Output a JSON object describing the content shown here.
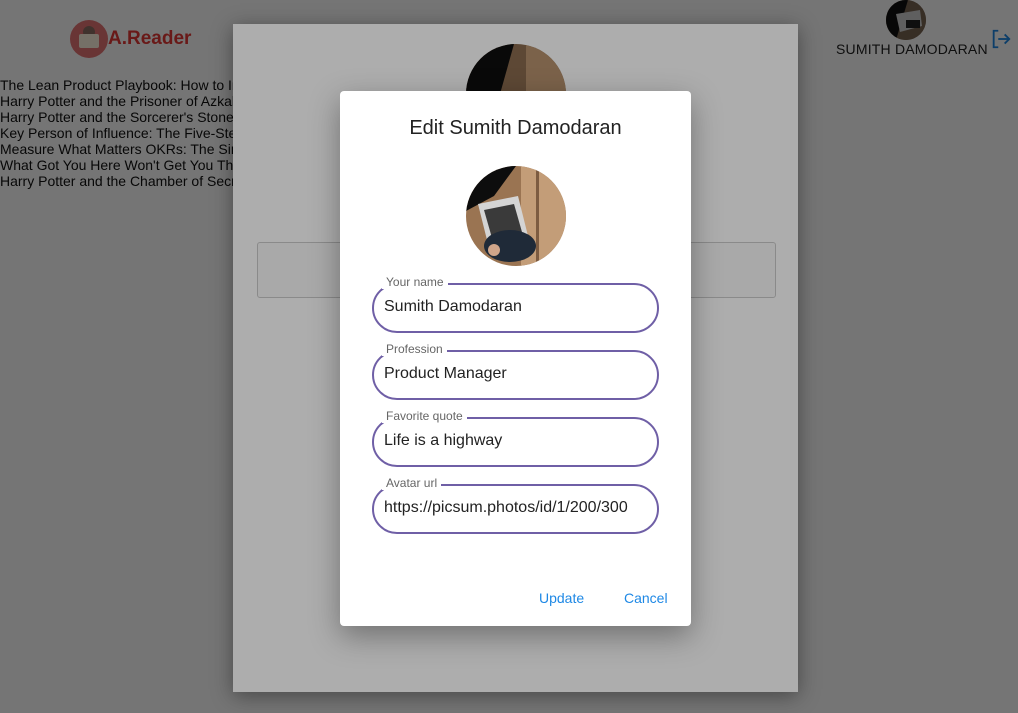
{
  "app": {
    "logo_text": "A.Reader"
  },
  "user": {
    "name": "SUMITH DAMODARAN"
  },
  "books": [
    "The Lean Product Playbook: How to Innovate with Minimum Viable Products",
    "Harry Potter and the Prisoner of Azkaban",
    "Harry Potter and the Sorcerer's Stone",
    "Key Person of Influence: The Five-Step Method",
    "Measure What Matters OKRs: The Simple Idea",
    "What Got You Here Won't Get You There",
    "Harry Potter and the Chamber of Secrets"
  ],
  "dialog": {
    "title": "Edit Sumith Damodaran",
    "fields": [
      {
        "label": "Your name",
        "value": "Sumith Damodaran"
      },
      {
        "label": "Profession",
        "value": "Product Manager"
      },
      {
        "label": "Favorite quote",
        "value": "Life is a highway"
      },
      {
        "label": "Avatar url",
        "value": "https://picsum.photos/id/1/200/300"
      }
    ],
    "update_label": "Update",
    "cancel_label": "Cancel"
  },
  "colors": {
    "accent": "#1e88e5",
    "field_outline": "#6f5fa6",
    "logo": "#e53935"
  },
  "icons": {
    "logout": "logout-icon"
  }
}
